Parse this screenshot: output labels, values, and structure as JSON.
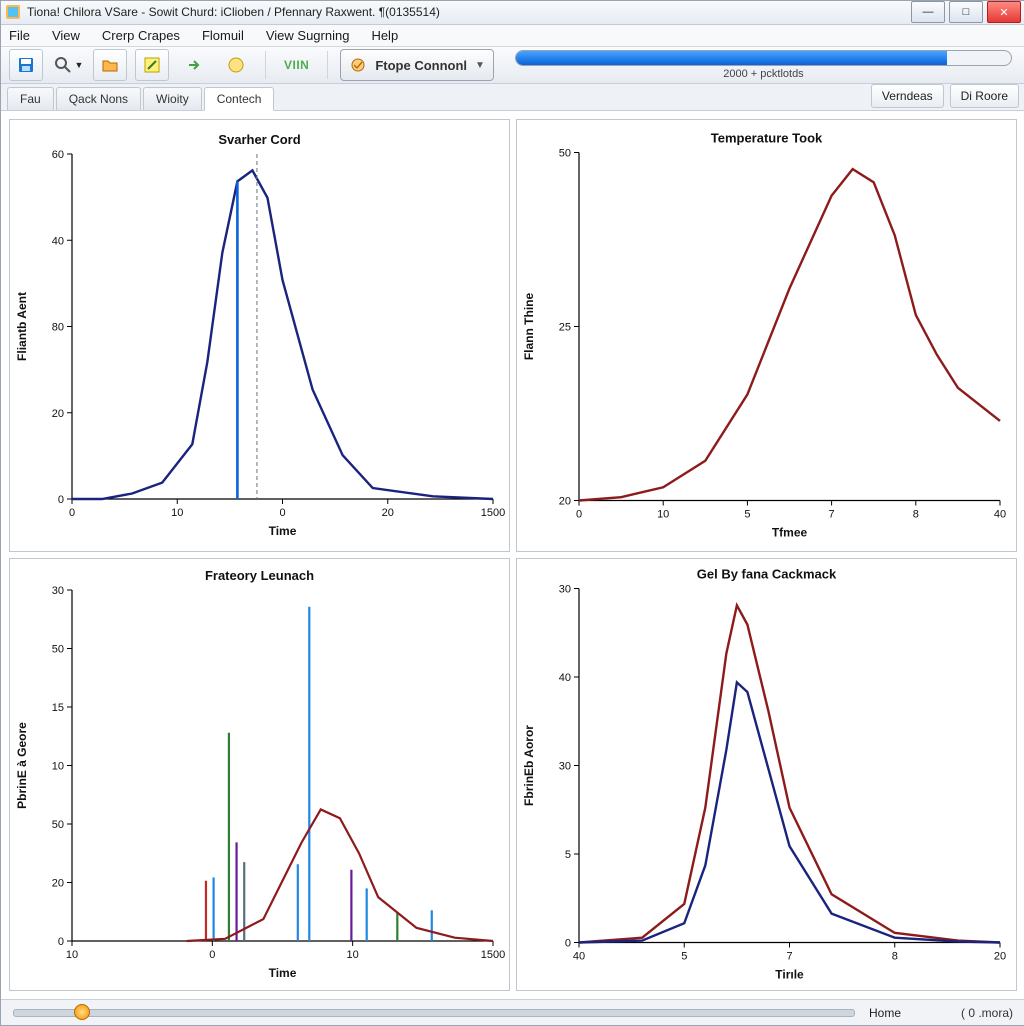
{
  "window": {
    "title": "Tiona! Chilora VSare - Sowit Churd: iClioben / Pfennary Raxwent. ¶(0135514)"
  },
  "menu": {
    "items": [
      "File",
      "View",
      "Crerp Crapes",
      "Flomuil",
      "View Sugrning",
      "Help"
    ]
  },
  "toolbar": {
    "viln_label": "VIIN",
    "combo_label": "Ftope Connonl",
    "progress_label": "2000 + pcktlotds",
    "progress_pct": 87
  },
  "tabs": {
    "items": [
      "Fau",
      "Qack Nons",
      "Wioity",
      "Contech"
    ],
    "active_index": 3,
    "right_buttons": [
      "Verndeas",
      "Di Roore"
    ]
  },
  "footer": {
    "home_label": "Home",
    "right_label": "( 0 .mora)"
  },
  "chart_data": [
    {
      "id": "svarher",
      "type": "line",
      "title": "Svarher Cord",
      "xlabel": "Time",
      "ylabel": "Fliantb Aent",
      "x_ticks": [
        0,
        10.0,
        0,
        20.0,
        1500
      ],
      "y_ticks": [
        0,
        20,
        80,
        40,
        60
      ],
      "series": [
        {
          "name": "curve",
          "color": "#1a237e",
          "x": [
            0,
            2,
            4,
            6,
            8,
            9,
            10,
            11,
            12,
            13,
            14,
            16,
            18,
            20,
            24,
            28
          ],
          "y": [
            0,
            0,
            1,
            3,
            10,
            25,
            45,
            58,
            60,
            55,
            40,
            20,
            8,
            2,
            0.5,
            0
          ]
        }
      ],
      "markers": [
        {
          "type": "bar",
          "x": 11,
          "y": 58,
          "color": "#0a63d8"
        },
        {
          "type": "vline",
          "x": 12.3,
          "color": "#6b7280"
        }
      ]
    },
    {
      "id": "temperature",
      "type": "line",
      "title": "Temperature Took",
      "xlabel": "Tfmee",
      "ylabel": "Flann Thine",
      "x_ticks": [
        0,
        10,
        5,
        7,
        8,
        40
      ],
      "y_ticks": [
        20,
        25,
        50
      ],
      "series": [
        {
          "name": "curve",
          "color": "#8e1b1b",
          "x": [
            0,
            4,
            8,
            12,
            16,
            20,
            24,
            26,
            28,
            30,
            32,
            34,
            36,
            40
          ],
          "y": [
            0,
            0.5,
            2,
            6,
            16,
            32,
            46,
            50,
            48,
            40,
            28,
            22,
            17,
            12
          ]
        }
      ]
    },
    {
      "id": "frateory",
      "type": "bar",
      "title": "Frateory Leunach",
      "xlabel": "Time",
      "ylabel": "PbrinE à Geore",
      "x_ticks": [
        10.0,
        0,
        10.0,
        1500
      ],
      "y_ticks": [
        0,
        20,
        50,
        10,
        15,
        50,
        30
      ],
      "bars": [
        {
          "x": 7.0,
          "y": 55,
          "color": "#c62828"
        },
        {
          "x": 7.4,
          "y": 58,
          "color": "#1e88e5"
        },
        {
          "x": 8.2,
          "y": 190,
          "color": "#2e7d32"
        },
        {
          "x": 8.6,
          "y": 90,
          "color": "#6a1b9a"
        },
        {
          "x": 9.0,
          "y": 72,
          "color": "#546e7a"
        },
        {
          "x": 11.8,
          "y": 70,
          "color": "#1e88e5"
        },
        {
          "x": 12.4,
          "y": 305,
          "color": "#1e88e5"
        },
        {
          "x": 14.6,
          "y": 65,
          "color": "#6a1b9a"
        },
        {
          "x": 15.4,
          "y": 48,
          "color": "#1e88e5"
        },
        {
          "x": 17.0,
          "y": 26,
          "color": "#2e7d32"
        },
        {
          "x": 18.8,
          "y": 28,
          "color": "#1e88e5"
        }
      ],
      "overlay_curve": {
        "color": "#8e1b1b",
        "x": [
          6,
          8,
          10,
          12,
          13,
          14,
          15,
          16,
          18,
          20,
          22
        ],
        "y": [
          0,
          2,
          20,
          90,
          120,
          112,
          80,
          40,
          12,
          3,
          0
        ]
      }
    },
    {
      "id": "gelby",
      "type": "line",
      "title": "Gel By fana Cackmack",
      "xlabel": "Tirıle",
      "ylabel": "FbrinEb Aoror",
      "x_ticks": [
        40,
        5,
        7,
        8,
        20
      ],
      "y_ticks": [
        0,
        5,
        30,
        40,
        30
      ],
      "series": [
        {
          "name": "red",
          "color": "#8e1b1b",
          "x": [
            0,
            3,
            5,
            6,
            7,
            7.5,
            8,
            9,
            10,
            12,
            15,
            18,
            20
          ],
          "y": [
            0,
            0.5,
            4,
            14,
            30,
            35,
            33,
            24,
            14,
            5,
            1,
            0.2,
            0
          ]
        },
        {
          "name": "blue",
          "color": "#1a237e",
          "x": [
            0,
            3,
            5,
            6,
            7,
            7.5,
            8,
            9,
            10,
            12,
            15,
            18,
            20
          ],
          "y": [
            0,
            0.2,
            2,
            8,
            20,
            27,
            26,
            18,
            10,
            3,
            0.5,
            0.1,
            0
          ]
        }
      ]
    }
  ]
}
